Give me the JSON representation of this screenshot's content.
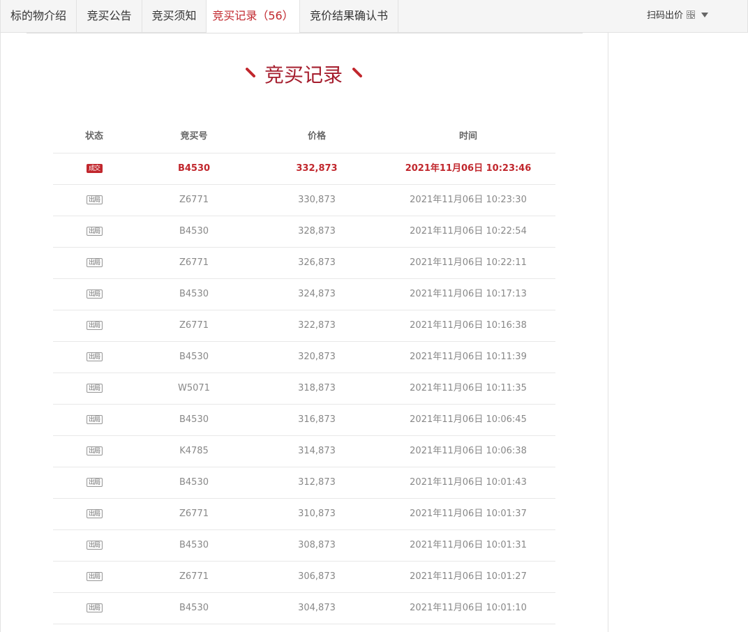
{
  "tabs": [
    {
      "label": "标的物介绍"
    },
    {
      "label": "竞买公告"
    },
    {
      "label": "竞买须知"
    },
    {
      "label": "竞买记录（56）"
    },
    {
      "label": "竞价结果确认书"
    }
  ],
  "scan_label": "扫码出价",
  "section_title": "竞买记录",
  "table": {
    "headers": [
      "状态",
      "竞买号",
      "价格",
      "时间"
    ],
    "rows": [
      {
        "status": "成交",
        "bidder": "B4530",
        "price": "332,873",
        "time": "2021年11月06日 10:23:46"
      },
      {
        "status": "出局",
        "bidder": "Z6771",
        "price": "330,873",
        "time": "2021年11月06日 10:23:30"
      },
      {
        "status": "出局",
        "bidder": "B4530",
        "price": "328,873",
        "time": "2021年11月06日 10:22:54"
      },
      {
        "status": "出局",
        "bidder": "Z6771",
        "price": "326,873",
        "time": "2021年11月06日 10:22:11"
      },
      {
        "status": "出局",
        "bidder": "B4530",
        "price": "324,873",
        "time": "2021年11月06日 10:17:13"
      },
      {
        "status": "出局",
        "bidder": "Z6771",
        "price": "322,873",
        "time": "2021年11月06日 10:16:38"
      },
      {
        "status": "出局",
        "bidder": "B4530",
        "price": "320,873",
        "time": "2021年11月06日 10:11:39"
      },
      {
        "status": "出局",
        "bidder": "W5071",
        "price": "318,873",
        "time": "2021年11月06日 10:11:35"
      },
      {
        "status": "出局",
        "bidder": "B4530",
        "price": "316,873",
        "time": "2021年11月06日 10:06:45"
      },
      {
        "status": "出局",
        "bidder": "K4785",
        "price": "314,873",
        "time": "2021年11月06日 10:06:38"
      },
      {
        "status": "出局",
        "bidder": "B4530",
        "price": "312,873",
        "time": "2021年11月06日 10:01:43"
      },
      {
        "status": "出局",
        "bidder": "Z6771",
        "price": "310,873",
        "time": "2021年11月06日 10:01:37"
      },
      {
        "status": "出局",
        "bidder": "B4530",
        "price": "308,873",
        "time": "2021年11月06日 10:01:31"
      },
      {
        "status": "出局",
        "bidder": "Z6771",
        "price": "306,873",
        "time": "2021年11月06日 10:01:27"
      },
      {
        "status": "出局",
        "bidder": "B4530",
        "price": "304,873",
        "time": "2021年11月06日 10:01:10"
      }
    ]
  },
  "colors": {
    "accent": "#c1272d",
    "title": "#a51d2d"
  },
  "icons": {
    "scan": "qr-code-icon",
    "dropdown": "caret-down-icon",
    "title_decoration": "pen-dash-icon"
  }
}
